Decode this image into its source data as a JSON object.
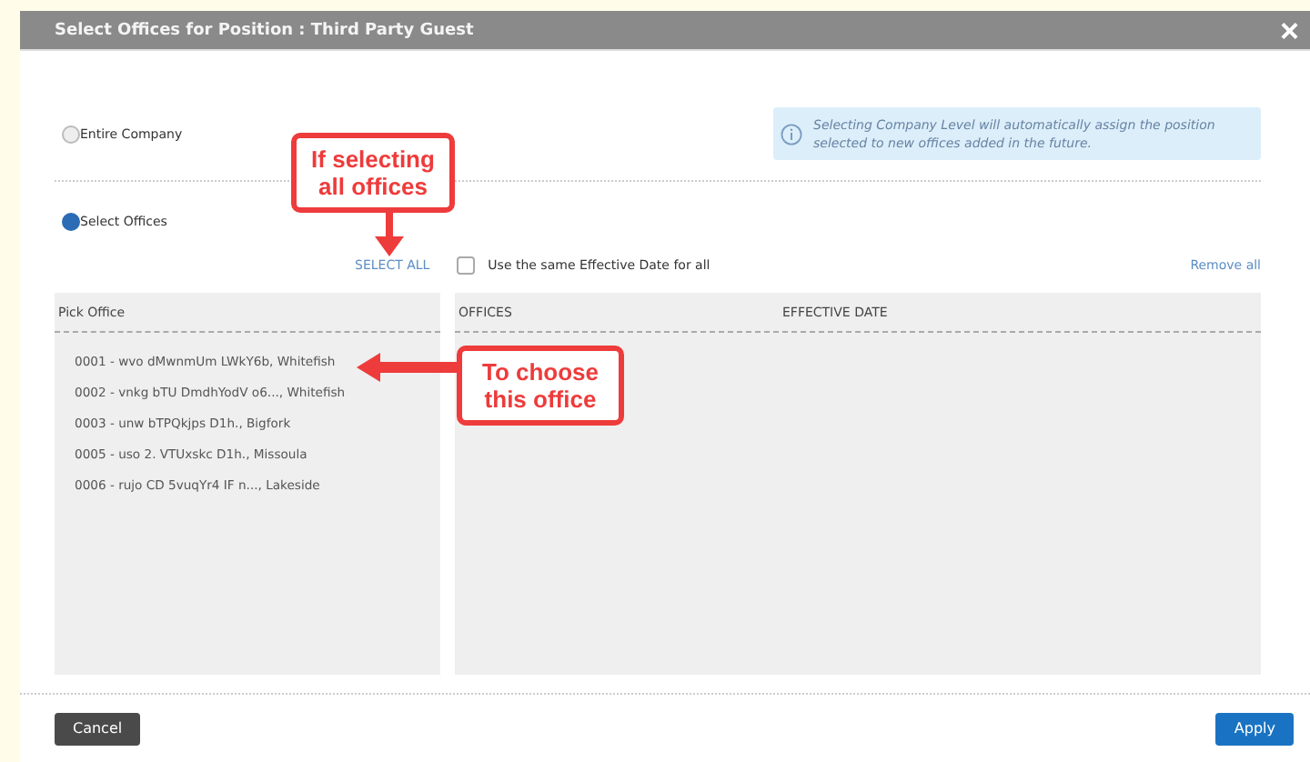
{
  "dialog": {
    "title": "Select Offices for Position : Third Party Guest",
    "close": "×"
  },
  "scope_options": [
    {
      "label": "Entire Company",
      "selected": false
    },
    {
      "label": "Select Offices",
      "selected": true
    }
  ],
  "info": "Selecting Company Level will automatically assign the position selected to new offices added in the future.",
  "select_all": "SELECT ALL",
  "same_date": {
    "label": "Use the same Effective Date for all",
    "checked": false
  },
  "remove_all": "Remove all",
  "pick_panel": {
    "header": "Pick Office",
    "offices": [
      "0001 - wvo dMwnmUm LWkY6b, Whitefish",
      "0002 - vnkg bTU DmdhYodV o6..., Whitefish",
      "0003 - unw bTPQkjps D1h., Bigfork",
      "0005 - uso 2. VTUxskc D1h., Missoula",
      "0006 - rujo CD 5vuqYr4 IF n..., Lakeside"
    ]
  },
  "selected_panel": {
    "columns": [
      "OFFICES",
      "EFFECTIVE DATE"
    ]
  },
  "buttons": {
    "cancel": "Cancel",
    "apply": "Apply"
  },
  "annotations": [
    {
      "kind": "down",
      "text": "If selecting all offices"
    },
    {
      "kind": "left",
      "text": "To choose this office"
    }
  ]
}
